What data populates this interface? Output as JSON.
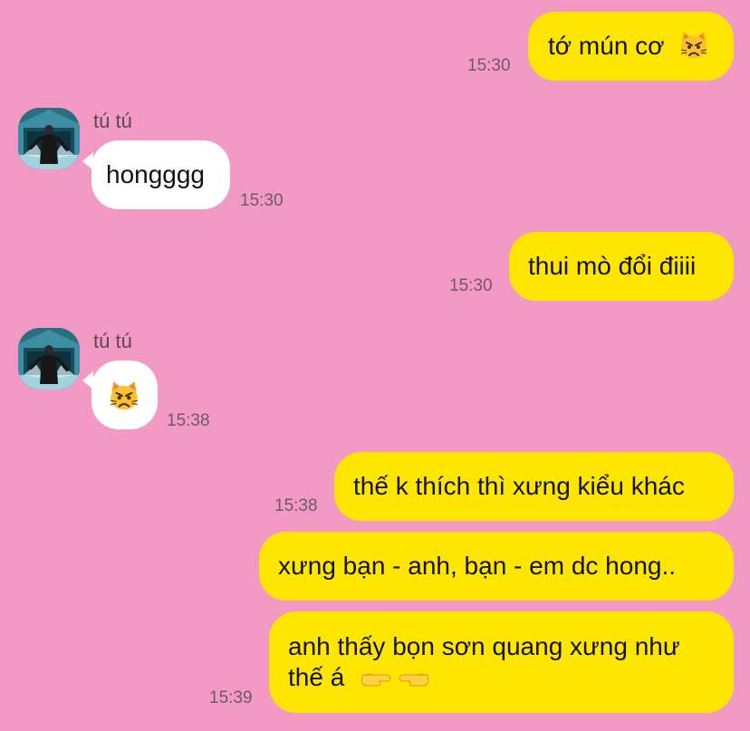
{
  "conversation": {
    "contact_name": "tú tú",
    "messages": [
      {
        "id": "m1",
        "direction": "sent",
        "text": "tớ mún cơ",
        "emoji": "pouting-cat-icon",
        "time": "15:30"
      },
      {
        "id": "m2",
        "direction": "received",
        "sender": "tú tú",
        "text": "hongggg",
        "time": "15:30"
      },
      {
        "id": "m3",
        "direction": "sent",
        "text": "thui mò đổi điiii",
        "time": "15:30"
      },
      {
        "id": "m4",
        "direction": "received",
        "sender": "tú tú",
        "text": "",
        "emoji": "pouting-cat-icon",
        "time": "15:38"
      },
      {
        "id": "m5",
        "direction": "sent",
        "text": "thế k thích thì xưng kiểu khác",
        "time": "15:38"
      },
      {
        "id": "m6",
        "direction": "sent",
        "text": "xưng bạn - anh, bạn - em dc hong..",
        "time": ""
      },
      {
        "id": "m7",
        "direction": "sent",
        "text_line1": "anh thấy bọn sơn quang xưng như",
        "text_line2": "thế á",
        "emoji": "pointing-hands-icon",
        "time": "15:39"
      }
    ]
  },
  "colors": {
    "background": "#f29ac3",
    "sent_bubble": "#ffe600",
    "received_bubble": "#ffffff",
    "timestamp": "#6e5966"
  }
}
